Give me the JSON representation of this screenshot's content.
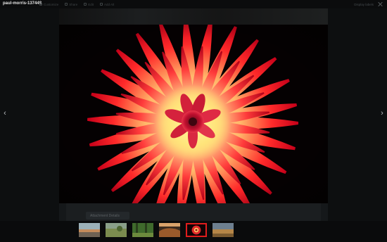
{
  "window": {
    "title": "paul-morris-137448"
  },
  "toolbar": {
    "items": [
      {
        "label": "Customize"
      },
      {
        "label": "Share"
      },
      {
        "label": "Edit"
      },
      {
        "label": "Add Alt"
      }
    ]
  },
  "right_controls": {
    "label": "Display labels"
  },
  "nav": {
    "prev": "‹",
    "next": "›"
  },
  "panel": {
    "tab_label": "Attachment Details"
  },
  "filmstrip": {
    "active_index": 4,
    "thumbnails": [
      {
        "name": "coastal-landscape"
      },
      {
        "name": "green-field"
      },
      {
        "name": "green-forest"
      },
      {
        "name": "canyon-sunset"
      },
      {
        "name": "red-flower"
      },
      {
        "name": "desert-landscape"
      }
    ]
  },
  "colors": {
    "accent": "#e11c1c",
    "background": "#0d0f10"
  }
}
